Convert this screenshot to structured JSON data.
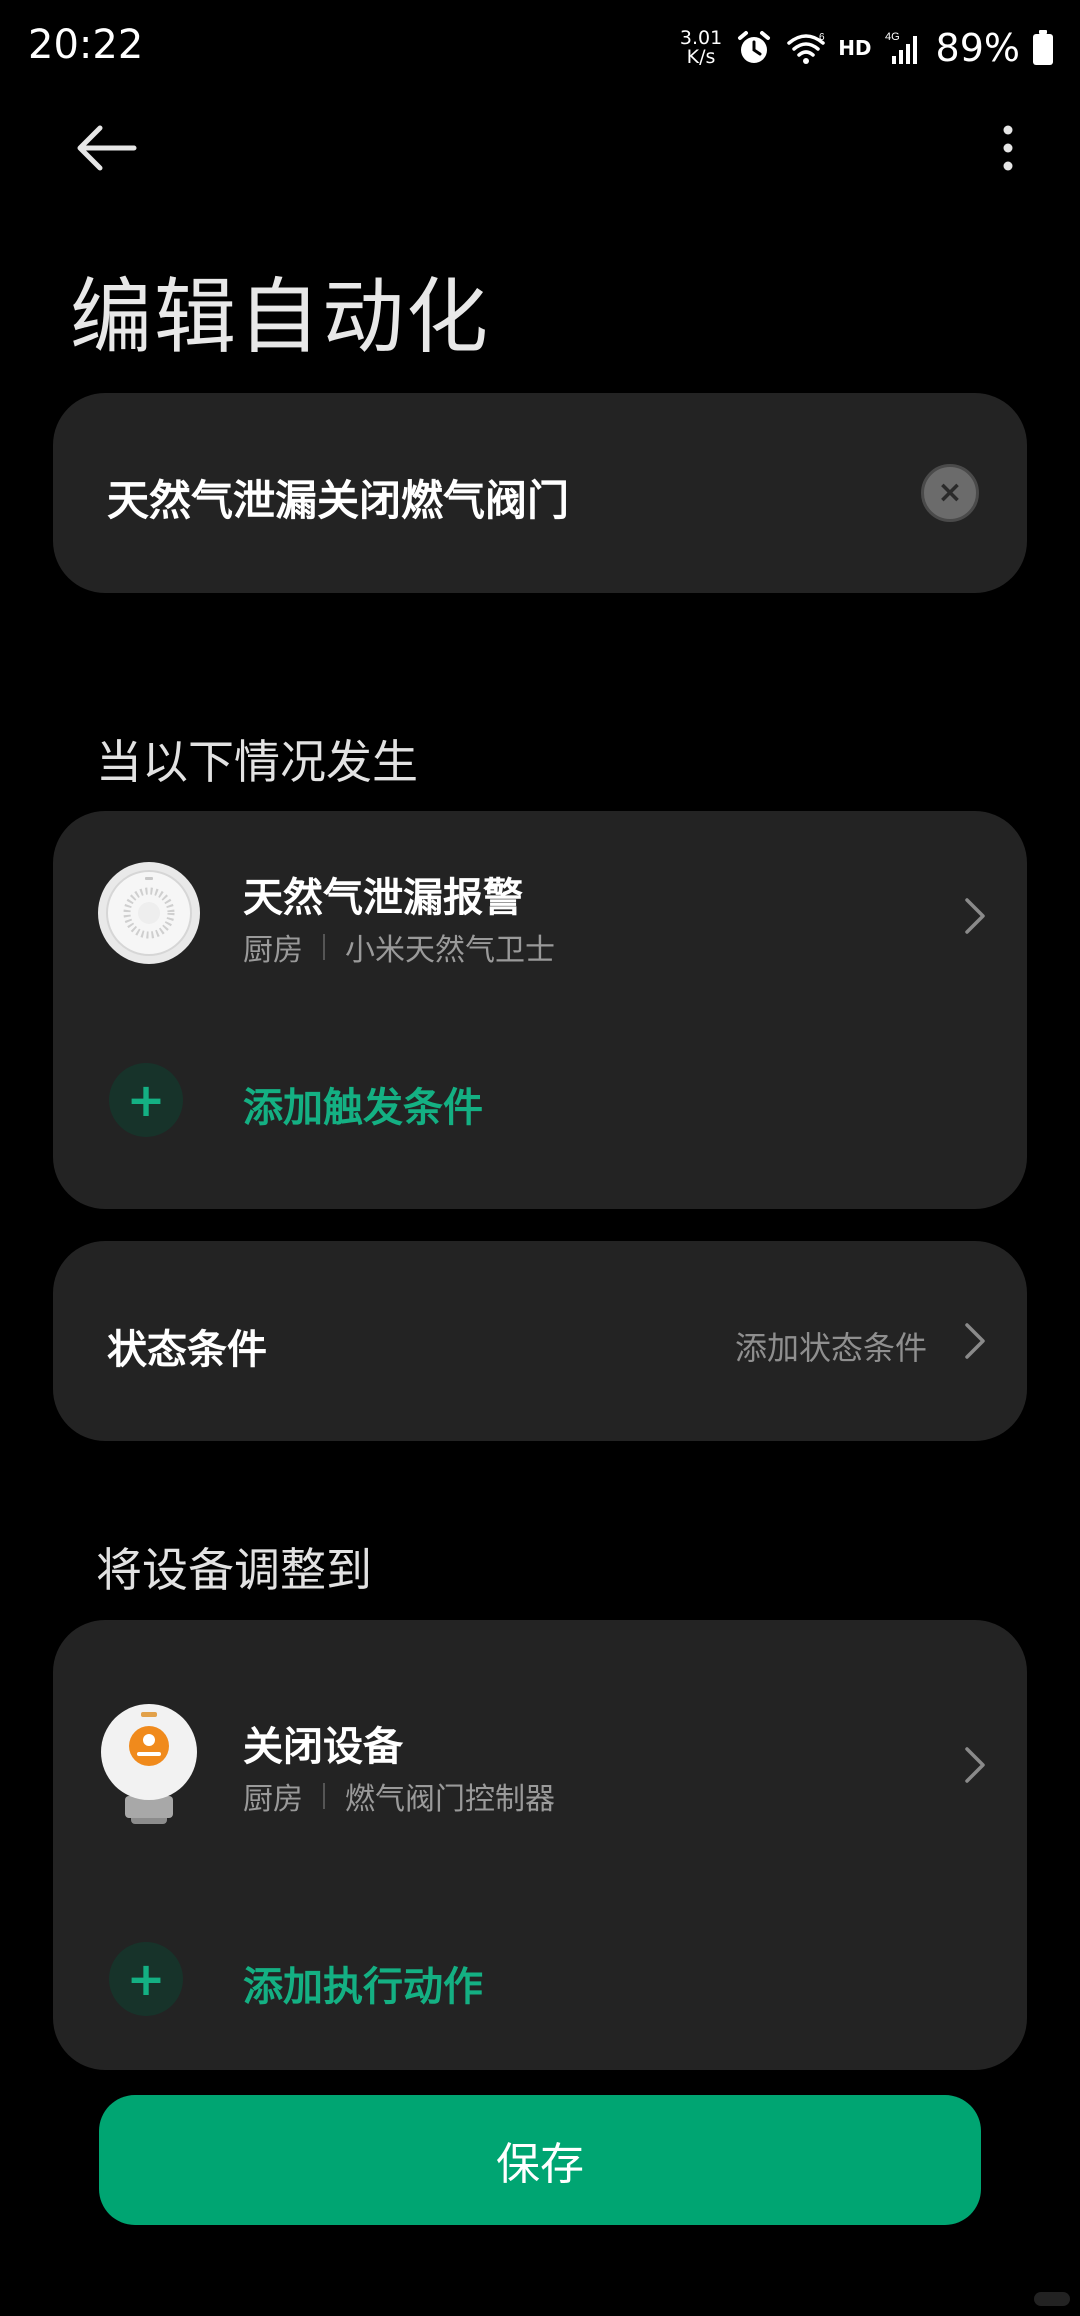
{
  "status_bar": {
    "time": "20:22",
    "net_speed_value": "3.01",
    "net_speed_unit": "K/s",
    "wifi_badge": "6",
    "hd": "HD",
    "network": "4G",
    "battery": "89%"
  },
  "header": {
    "title": "编辑自动化"
  },
  "automation": {
    "name": "天然气泄漏关闭燃气阀门"
  },
  "trigger_section": {
    "label": "当以下情况发生",
    "device": {
      "title": "天然气泄漏报警",
      "room": "厨房",
      "device_name": "小米天然气卫士"
    },
    "add_label": "添加触发条件"
  },
  "state_condition": {
    "title": "状态条件",
    "value": "添加状态条件"
  },
  "action_section": {
    "label": "将设备调整到",
    "device": {
      "title": "关闭设备",
      "room": "厨房",
      "device_name": "燃气阀门控制器"
    },
    "add_label": "添加执行动作"
  },
  "save_label": "保存",
  "colors": {
    "accent": "#14b083",
    "save_button": "#00a572",
    "card_bg": "#232323"
  }
}
